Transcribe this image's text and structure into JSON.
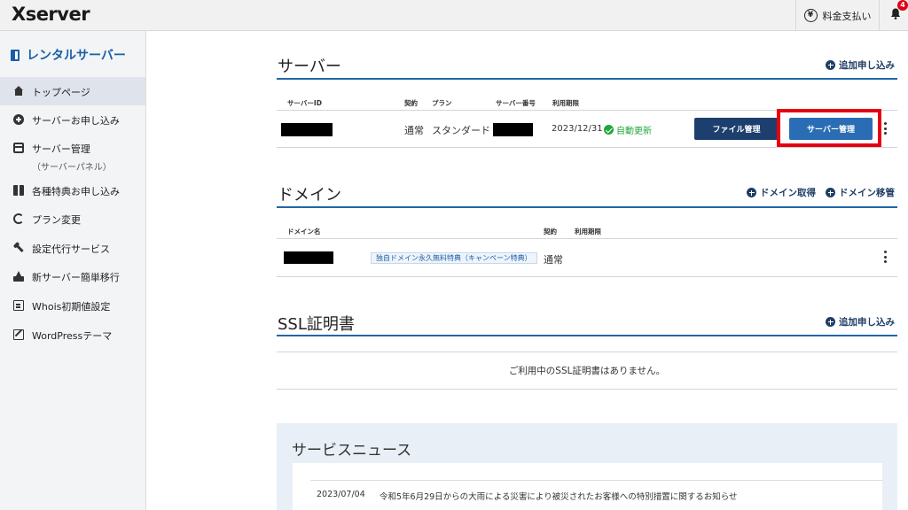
{
  "topbar": {
    "logo": "Xserver",
    "payment_label": "料金支払い",
    "payment_icon": "yen-icon",
    "notification_icon": "bell-icon",
    "notification_count": "4"
  },
  "sidebar": {
    "heading": "レンタルサーバー",
    "items": [
      {
        "label": "トップページ",
        "sub": "",
        "icon": "home-icon",
        "active": true
      },
      {
        "label": "サーバーお申し込み",
        "sub": "",
        "icon": "plus-circle-icon"
      },
      {
        "label": "サーバー管理",
        "sub": "（サーバーパネル）",
        "icon": "server-icon"
      },
      {
        "label": "各種特典お申し込み",
        "sub": "",
        "icon": "gift-icon"
      },
      {
        "label": "プラン変更",
        "sub": "",
        "icon": "sync-icon"
      },
      {
        "label": "設定代行サービス",
        "sub": "",
        "icon": "wrench-icon"
      },
      {
        "label": "新サーバー簡単移行",
        "sub": "",
        "icon": "move-icon"
      },
      {
        "label": "Whois初期値設定",
        "sub": "",
        "icon": "document-icon"
      },
      {
        "label": "WordPressテーマ",
        "sub": "",
        "icon": "edit-icon"
      }
    ]
  },
  "server": {
    "title": "サーバー",
    "add_link": "追加申し込み",
    "headers": {
      "id": "サーバーID",
      "contract": "契約",
      "plan": "プラン",
      "number": "サーバー番号",
      "expiry": "利用期限"
    },
    "row": {
      "contract": "通常",
      "plan": "スタンダード",
      "expiry": "2023/12/31",
      "auto_renew": "自動更新",
      "file_button": "ファイル管理",
      "manage_button": "サーバー管理"
    }
  },
  "domain": {
    "title": "ドメイン",
    "acquire_link": "ドメイン取得",
    "transfer_link": "ドメイン移管",
    "headers": {
      "name": "ドメイン名",
      "contract": "契約",
      "expiry": "利用期限"
    },
    "row": {
      "tag": "独自ドメイン永久無料特典（キャンペーン特典）",
      "contract": "通常"
    }
  },
  "ssl": {
    "title": "SSL証明書",
    "add_link": "追加申し込み",
    "empty": "ご利用中のSSL証明書はありません。"
  },
  "news": {
    "title": "サービスニュース",
    "items": [
      {
        "date": "2023/07/04",
        "text": "令和5年6月29日からの大雨による災害により被災されたお客様への特別措置に関するお知らせ"
      }
    ]
  },
  "colors": {
    "accent": "#2266a8",
    "dark_button": "#1c3f6e",
    "primary_button": "#2a6db5",
    "highlight": "#e60012",
    "success": "#20a83a"
  }
}
